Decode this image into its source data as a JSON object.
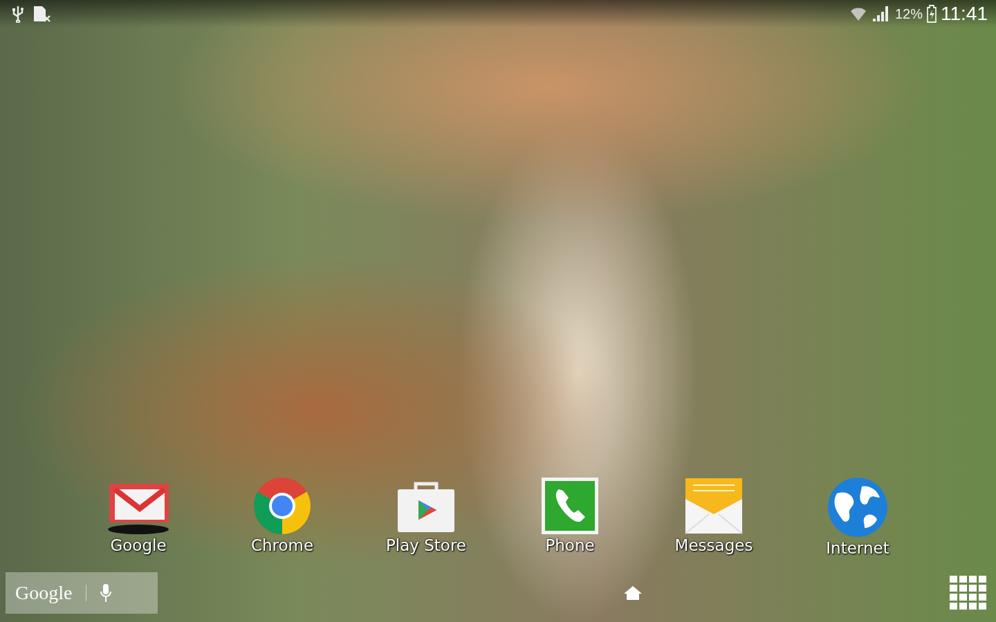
{
  "status_bar": {
    "battery": "12%",
    "time": "11:41"
  },
  "apps": [
    {
      "label": "Google",
      "kind": "gmail"
    },
    {
      "label": "Chrome",
      "kind": "chrome"
    },
    {
      "label": "Play Store",
      "kind": "store"
    },
    {
      "label": "Phone",
      "kind": "phone"
    },
    {
      "label": "Messages",
      "kind": "messages"
    },
    {
      "label": "Internet",
      "kind": "globe"
    }
  ],
  "search_bar": {
    "logo": "Google"
  }
}
